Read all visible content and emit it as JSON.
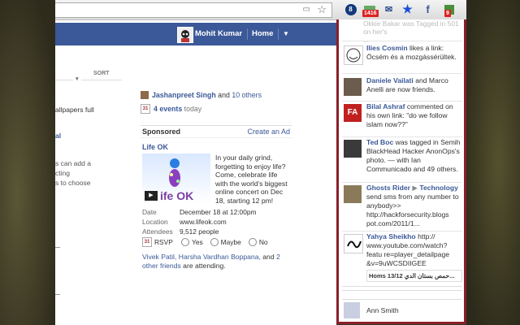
{
  "profile": {
    "name": "Mohit Kumar",
    "home": "Home"
  },
  "extensions": {
    "badge1": "1416",
    "badge2": "9"
  },
  "feed": {
    "sort_label": "SORT",
    "left_fragments": [
      "allpapers full",
      "al",
      "s can add a",
      "cting",
      "s to choose"
    ]
  },
  "sidebar": {
    "friend_line": {
      "name": "Jashanpreet Singh",
      "mid": "and",
      "others": "10 others"
    },
    "events": {
      "count": "4 events",
      "suffix": "today"
    },
    "sponsored": "Sponsored",
    "create_ad": "Create an Ad",
    "ad": {
      "title": "Life OK",
      "image_text": "ife OK",
      "body": "In your daily grind, forgetting to enjoy life? Come, celebrate life with the world's biggest online concert on Dec 18, starting 12 pm!",
      "details": [
        {
          "label": "Date",
          "value": "December 18 at 12:00pm"
        },
        {
          "label": "Location",
          "value": "www.lifeok.com"
        },
        {
          "label": "Attendees",
          "value": "9,512 people"
        }
      ],
      "rsvp_label": "RSVP",
      "rsvp_options": [
        "Yes",
        "Maybe",
        "No"
      ],
      "attending": {
        "names": "Vivek Patil, Harsha Vardhan Boppana,",
        "and": "and",
        "others": "2 other friends",
        "suffix": "are attending."
      }
    }
  },
  "ticker": {
    "ghost_top": [
      "Okkie Bakar was Tagged in 501 on her's",
      "... "
    ],
    "stories": [
      {
        "name": "Ilies Cosmin",
        "text": "likes a link: Öcsém és a mozgássérültek."
      },
      {
        "name": "Daniele Vailati",
        "text": "and Marco Anelli are now friends."
      },
      {
        "name": "Bilal Ashraf",
        "text": "commented on his own link: \"do we follow islam now??\""
      },
      {
        "name": "Ted Boc",
        "text": "was tagged in Semih BlackHead Hacker AnonOps's photo. — with Ian Communicado and 49 others."
      },
      {
        "name": "Ghosts Rider",
        "arrow": "▶",
        "target": "Technology",
        "text": "send sms from any number to anybody>> http://hackforsecurity.blogs pot.com/2011/1..."
      },
      {
        "name": "Yahya Sheikho",
        "text": "http:// www.youtube.com/watch?featu re=player_detailpage &v=9uWCSDIIGEE",
        "sub": "Homs 13/12 حمص بستان الدي..."
      }
    ],
    "chat_contact": "Ann Smith"
  }
}
